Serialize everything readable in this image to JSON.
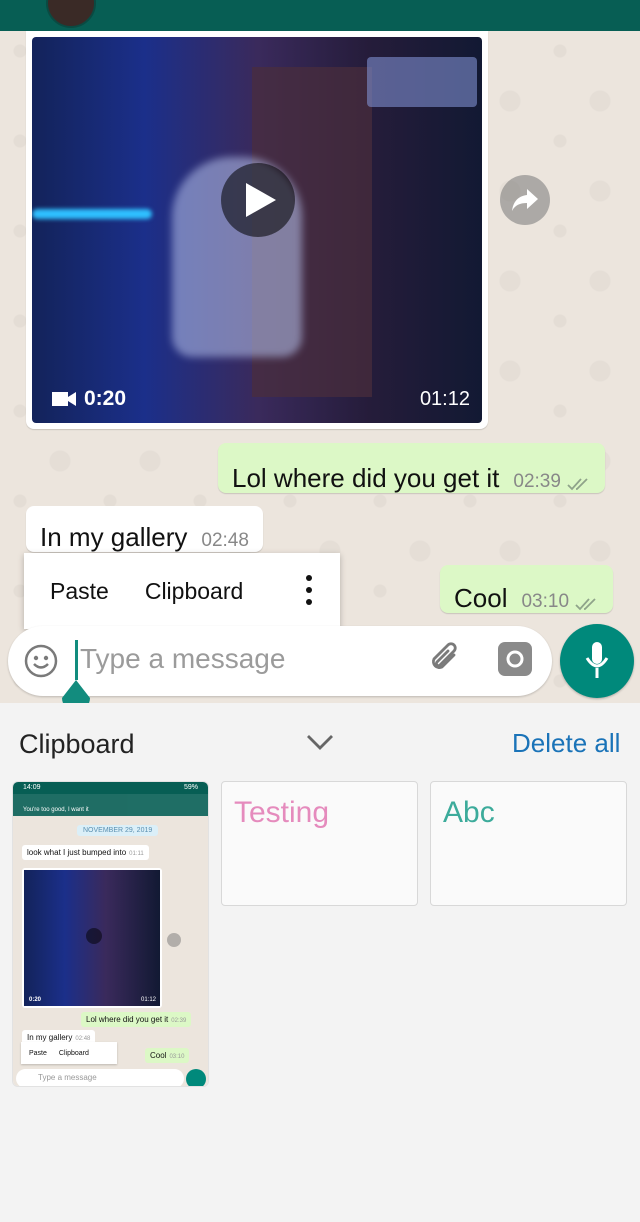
{
  "chat": {
    "video": {
      "duration": "0:20",
      "time": "01:12"
    },
    "messages": [
      {
        "text": "Lol where did you get it",
        "time": "02:39",
        "direction": "out"
      },
      {
        "text": "In my gallery",
        "time": "02:48",
        "direction": "in"
      },
      {
        "text": "Cool",
        "time": "03:10",
        "direction": "out"
      }
    ]
  },
  "context_menu": {
    "paste": "Paste",
    "clipboard": "Clipboard"
  },
  "composer": {
    "placeholder": "Type a message"
  },
  "clipboard_panel": {
    "title": "Clipboard",
    "delete_all": "Delete all",
    "items": [
      {
        "type": "screenshot",
        "status_time": "14:09",
        "status_battery": "59%",
        "header_text": "You're too good, I want it",
        "date_label": "NOVEMBER 29, 2019",
        "msg1": "look what I just bumped into",
        "msg1_time": "01:11",
        "video_duration": "0:20",
        "video_time": "01:12",
        "msg2": "Lol where did you get it",
        "msg2_time": "02:39",
        "msg3": "In my gallery",
        "msg3_time": "02:48",
        "menu_paste": "Paste",
        "menu_clipboard": "Clipboard",
        "msg4": "Cool",
        "msg4_time": "03:10",
        "composer_placeholder": "Type a message"
      },
      {
        "type": "text",
        "text": "Testing"
      },
      {
        "type": "text",
        "text": "Abc"
      }
    ]
  },
  "colors": {
    "header": "#075e54",
    "accent": "#00897b",
    "outgoing_bubble": "#dcf8c6",
    "link_blue": "#1a73b8"
  }
}
